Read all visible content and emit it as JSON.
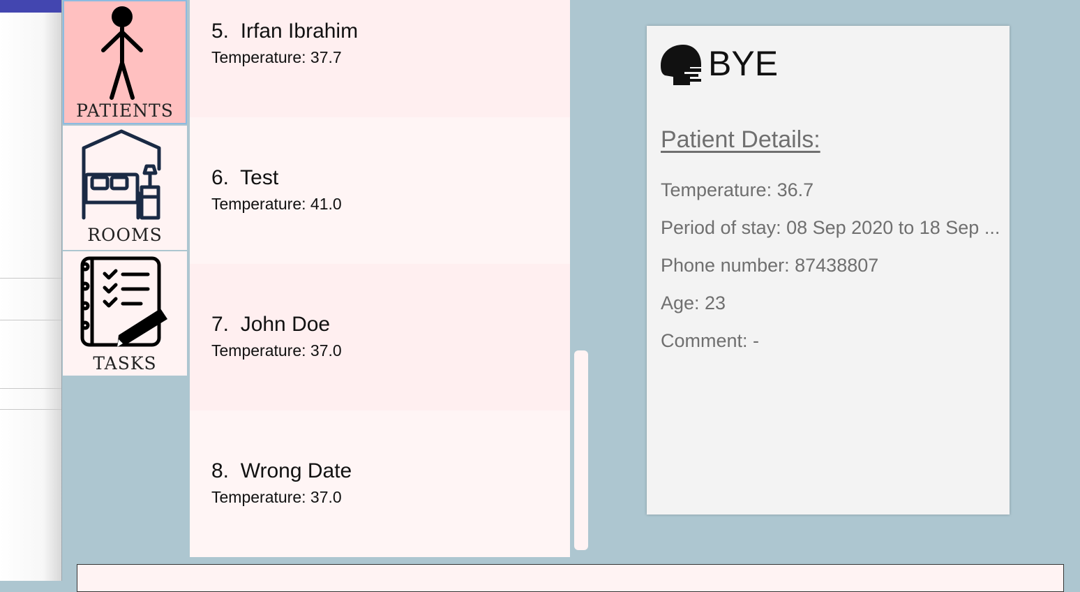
{
  "nav": {
    "patients_label": "PATIENTS",
    "rooms_label": "ROOMS",
    "tasks_label": "TASKS"
  },
  "patients": [
    {
      "name": "5.  Irfan Ibrahim",
      "temperature": "Temperature: 37.7"
    },
    {
      "name": "6.  Test",
      "temperature": "Temperature: 41.0"
    },
    {
      "name": "7.  John Doe",
      "temperature": "Temperature: 37.0"
    },
    {
      "name": "8.  Wrong Date",
      "temperature": "Temperature: 37.0"
    }
  ],
  "details": {
    "title": "BYE",
    "heading": "Patient Details:",
    "temperature": "Temperature: 36.7",
    "period": "Period of stay: 08 Sep 2020 to 18 Sep ...",
    "phone": "Phone number: 87438807",
    "age": "Age: 23",
    "comment": "Comment: -"
  },
  "colors": {
    "background": "#adc6d0",
    "active_nav": "#ffc0c0",
    "card": "#fff3f3"
  }
}
